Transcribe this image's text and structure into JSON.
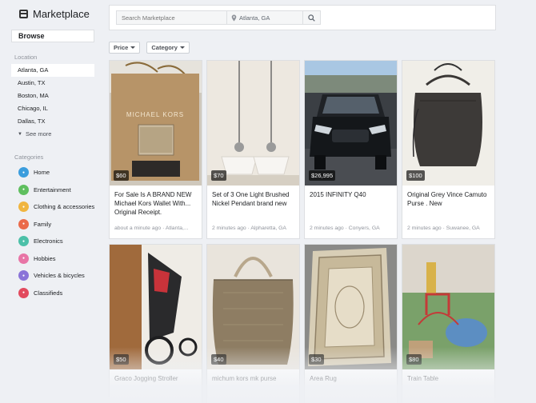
{
  "header": {
    "title": "Marketplace"
  },
  "sidebar": {
    "browse_label": "Browse",
    "location_label": "Location",
    "locations": [
      "Atlanta, GA",
      "Austin, TX",
      "Boston, MA",
      "Chicago, IL",
      "Dallas, TX"
    ],
    "see_more": "See more",
    "categories_label": "Categories",
    "categories": [
      {
        "label": "Home",
        "icon": "home-icon",
        "color": "#3b9ddd"
      },
      {
        "label": "Entertainment",
        "icon": "entertainment-icon",
        "color": "#5fbf5f"
      },
      {
        "label": "Clothing & accessories",
        "icon": "clothing-icon",
        "color": "#f0b53f"
      },
      {
        "label": "Family",
        "icon": "family-icon",
        "color": "#ea6a4a"
      },
      {
        "label": "Electronics",
        "icon": "electronics-icon",
        "color": "#4cc0a8"
      },
      {
        "label": "Hobbies",
        "icon": "hobbies-icon",
        "color": "#e875a6"
      },
      {
        "label": "Vehicles & bicycles",
        "icon": "vehicles-icon",
        "color": "#8a74d8"
      },
      {
        "label": "Classifieds",
        "icon": "classifieds-icon",
        "color": "#e24a5e"
      }
    ]
  },
  "search": {
    "placeholder": "Search Marketplace",
    "location_value": "Atlanta, GA"
  },
  "filters": {
    "price": "Price",
    "category": "Category"
  },
  "listings": [
    {
      "price": "$60",
      "title": "For Sale Is A BRAND NEW Michael Kors Wallet With... Original Receipt.",
      "meta": "about a minute ago · Atlanta,..."
    },
    {
      "price": "$70",
      "title": "Set of 3 One Light Brushed Nickel Pendant brand new",
      "meta": "2 minutes ago · Alpharetta, GA"
    },
    {
      "price": "$26,995",
      "title": "2015 INFINITY Q40",
      "meta": "2 minutes ago · Conyers, GA"
    },
    {
      "price": "$100",
      "title": "Original Grey Vince Camuto Purse . New",
      "meta": "2 minutes ago · Suwanee, GA"
    },
    {
      "price": "$50",
      "title": "Graco Jogging Stroller",
      "meta": ""
    },
    {
      "price": "$40",
      "title": "michum kors mk purse",
      "meta": ""
    },
    {
      "price": "$30",
      "title": "Area Rug",
      "meta": ""
    },
    {
      "price": "$80",
      "title": "Train Table",
      "meta": ""
    }
  ]
}
